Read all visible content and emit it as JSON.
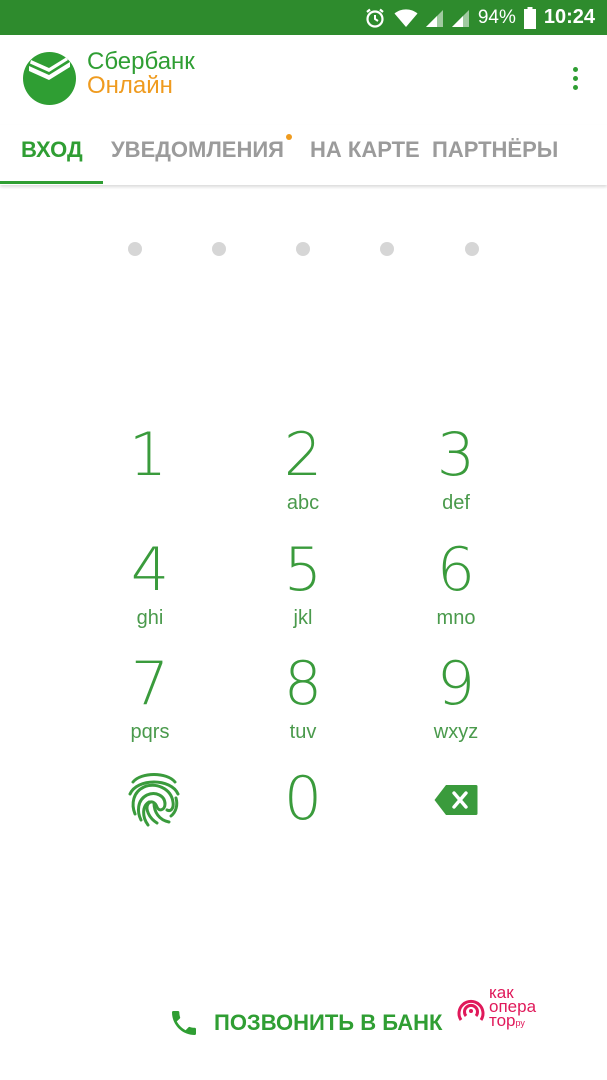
{
  "status_bar": {
    "battery_percent": "94%",
    "time": "10:24",
    "icons": [
      "alarm-icon",
      "wifi-icon",
      "signal-icon",
      "signal-icon",
      "battery-icon"
    ],
    "bg_color": "#2e8b2d"
  },
  "header": {
    "brand_line1": "Сбербанк",
    "brand_line2": "Онлайн",
    "brand_color": "#2f9e33",
    "accent_color": "#ef9b1f"
  },
  "tabs": [
    {
      "label": "ВХОД",
      "active": true
    },
    {
      "label": "УВЕДОМЛЕНИЯ",
      "active": false,
      "badge": true
    },
    {
      "label": "НА КАРТЕ",
      "active": false
    },
    {
      "label": "ПАРТНЁРЫ",
      "active": false
    }
  ],
  "pin": {
    "length": 5,
    "entered": 0
  },
  "keypad": {
    "keys": [
      {
        "digit": "1",
        "letters": ""
      },
      {
        "digit": "2",
        "letters": "abc"
      },
      {
        "digit": "3",
        "letters": "def"
      },
      {
        "digit": "4",
        "letters": "ghi"
      },
      {
        "digit": "5",
        "letters": "jkl"
      },
      {
        "digit": "6",
        "letters": "mno"
      },
      {
        "digit": "7",
        "letters": "pqrs"
      },
      {
        "digit": "8",
        "letters": "tuv"
      },
      {
        "digit": "9",
        "letters": "wxyz"
      },
      {
        "digit": "0",
        "letters": ""
      }
    ],
    "fingerprint_icon": "fingerprint-icon",
    "backspace_icon": "backspace-icon"
  },
  "call_bank": {
    "label": "ПОЗВОНИТЬ В БАНК",
    "icon": "phone-icon"
  },
  "watermark": {
    "line1": "как",
    "line2": "опера",
    "line3": "тор",
    "suffix": "ру"
  }
}
